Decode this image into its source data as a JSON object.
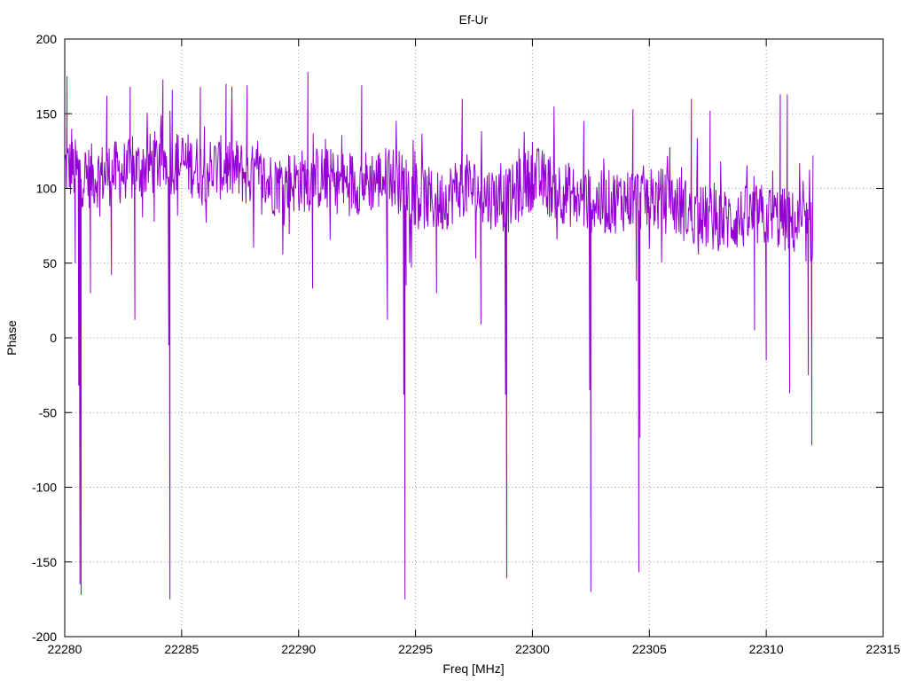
{
  "chart_data": {
    "type": "line",
    "title": "Ef-Ur",
    "xlabel": "Freq [MHz]",
    "ylabel": "Phase",
    "xlim": [
      22280,
      22315
    ],
    "ylim": [
      -200,
      200
    ],
    "xticks": [
      22280,
      22285,
      22290,
      22295,
      22300,
      22305,
      22310,
      22315
    ],
    "yticks": [
      -200,
      -150,
      -100,
      -50,
      0,
      50,
      100,
      150,
      200
    ],
    "x_tick_labels": [
      "22280",
      "22285",
      "22290",
      "22295",
      "22300",
      "22305",
      "22310",
      "22315"
    ],
    "y_tick_labels": [
      "-200",
      "-150",
      "-100",
      "-50",
      "0",
      "50",
      "100",
      "150",
      "200"
    ],
    "grid": true,
    "series": [
      {
        "color": "#9400d3",
        "x_range": [
          22280,
          22312
        ],
        "x_step": 0.025,
        "baseline": [
          [
            22280,
            115
          ],
          [
            22281,
            108
          ],
          [
            22282,
            110
          ],
          [
            22283,
            112
          ],
          [
            22284,
            118
          ],
          [
            22285,
            117
          ],
          [
            22286,
            113
          ],
          [
            22287,
            114
          ],
          [
            22288,
            108
          ],
          [
            22289,
            103
          ],
          [
            22290,
            105
          ],
          [
            22291,
            107
          ],
          [
            22292,
            103
          ],
          [
            22293,
            105
          ],
          [
            22294,
            108
          ],
          [
            22295,
            96
          ],
          [
            22296,
            90
          ],
          [
            22297,
            103
          ],
          [
            22298,
            95
          ],
          [
            22299,
            92
          ],
          [
            22300,
            108
          ],
          [
            22301,
            100
          ],
          [
            22302,
            93
          ],
          [
            22303,
            90
          ],
          [
            22304,
            93
          ],
          [
            22305,
            94
          ],
          [
            22306,
            90
          ],
          [
            22307,
            82
          ],
          [
            22308,
            78
          ],
          [
            22309,
            80
          ],
          [
            22310,
            82
          ],
          [
            22311,
            78
          ],
          [
            22312,
            70
          ]
        ],
        "noise_amplitude": 22,
        "spikes": [
          {
            "x": 22280.1,
            "y": 175
          },
          {
            "x": 22280.3,
            "y": 140
          },
          {
            "x": 22280.45,
            "y": 50
          },
          {
            "x": 22280.6,
            "y": -32
          },
          {
            "x": 22280.65,
            "y": -165
          },
          {
            "x": 22280.7,
            "y": -172
          },
          {
            "x": 22281.1,
            "y": 30
          },
          {
            "x": 22281.8,
            "y": 162
          },
          {
            "x": 22282.0,
            "y": 42
          },
          {
            "x": 22282.8,
            "y": 168
          },
          {
            "x": 22283.0,
            "y": 12
          },
          {
            "x": 22284.2,
            "y": 173
          },
          {
            "x": 22284.45,
            "y": -5
          },
          {
            "x": 22284.5,
            "y": -175
          },
          {
            "x": 22284.6,
            "y": 166
          },
          {
            "x": 22285.8,
            "y": 168
          },
          {
            "x": 22286.9,
            "y": 170
          },
          {
            "x": 22287.8,
            "y": 169
          },
          {
            "x": 22290.4,
            "y": 178
          },
          {
            "x": 22290.6,
            "y": 33
          },
          {
            "x": 22292.7,
            "y": 169
          },
          {
            "x": 22293.8,
            "y": 12
          },
          {
            "x": 22294.5,
            "y": -38
          },
          {
            "x": 22294.55,
            "y": -175
          },
          {
            "x": 22294.6,
            "y": 35
          },
          {
            "x": 22295.9,
            "y": 30
          },
          {
            "x": 22297.0,
            "y": 160
          },
          {
            "x": 22297.8,
            "y": 9
          },
          {
            "x": 22298.85,
            "y": -38
          },
          {
            "x": 22298.9,
            "y": -161
          },
          {
            "x": 22302.2,
            "y": 145
          },
          {
            "x": 22302.45,
            "y": -35
          },
          {
            "x": 22302.5,
            "y": -170
          },
          {
            "x": 22304.3,
            "y": 153
          },
          {
            "x": 22304.45,
            "y": 38
          },
          {
            "x": 22304.55,
            "y": -157
          },
          {
            "x": 22304.6,
            "y": -67
          },
          {
            "x": 22306.8,
            "y": 160
          },
          {
            "x": 22307.6,
            "y": 152
          },
          {
            "x": 22309.5,
            "y": 5
          },
          {
            "x": 22310.0,
            "y": -15
          },
          {
            "x": 22310.6,
            "y": 163
          },
          {
            "x": 22310.9,
            "y": 163
          },
          {
            "x": 22311.0,
            "y": -37
          },
          {
            "x": 22311.8,
            "y": -25
          },
          {
            "x": 22311.95,
            "y": -72
          },
          {
            "x": 22312.0,
            "y": 122
          }
        ]
      }
    ]
  }
}
